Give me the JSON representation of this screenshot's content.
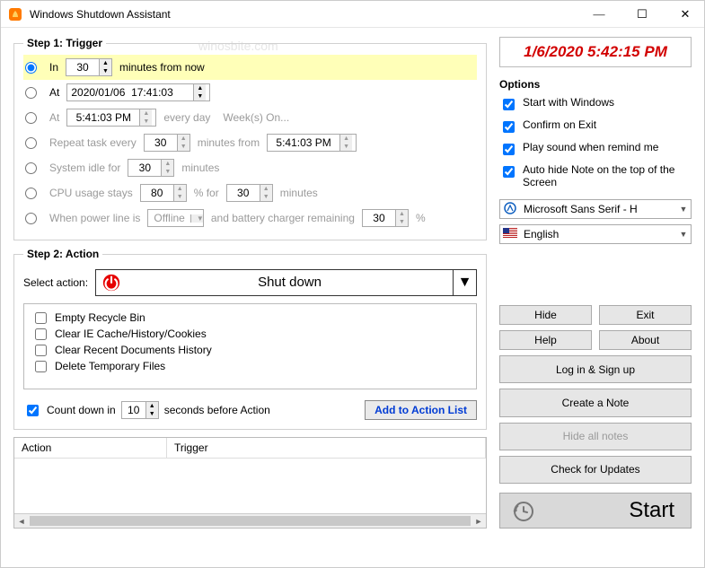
{
  "window": {
    "title": "Windows Shutdown Assistant"
  },
  "watermark": "winosbite.com",
  "step1": {
    "legend": "Step 1: Trigger",
    "in_label": "In",
    "in_value": "30",
    "in_suffix": "minutes from now",
    "at1_label": "At",
    "at1_value": "2020/01/06  17:41:03",
    "at2_label": "At",
    "at2_value": "5:41:03 PM",
    "at2_suffix1": "every day",
    "at2_suffix2": "Week(s) On...",
    "repeat_label": "Repeat task every",
    "repeat_value": "30",
    "repeat_mid": "minutes from",
    "repeat_time": "5:41:03 PM",
    "idle_label": "System idle for",
    "idle_value": "30",
    "idle_suffix": "minutes",
    "cpu_label": "CPU usage stays",
    "cpu_value": "80",
    "cpu_mid": "% for",
    "cpu_min": "30",
    "cpu_suffix": "minutes",
    "power_label": "When power line is",
    "power_state": "Offline",
    "power_mid": "and battery charger remaining",
    "power_val": "30",
    "power_suffix": "%"
  },
  "step2": {
    "legend": "Step 2: Action",
    "select_label": "Select action:",
    "action": "Shut down",
    "checks": {
      "c1": "Empty Recycle Bin",
      "c2": "Clear IE Cache/History/Cookies",
      "c3": "Clear Recent Documents History",
      "c4": "Delete Temporary Files"
    },
    "countdown_label": "Count down in",
    "countdown_value": "10",
    "countdown_suffix": "seconds before Action",
    "add_btn": "Add to Action List"
  },
  "list": {
    "h1": "Action",
    "h2": "Trigger"
  },
  "clock": "1/6/2020 5:42:15 PM",
  "options": {
    "head": "Options",
    "o1": "Start with Windows",
    "o2": "Confirm on Exit",
    "o3": "Play sound when remind me",
    "o4": "Auto hide Note on the top of the Screen"
  },
  "font_select": "Microsoft Sans Serif    - H",
  "lang_select": "English",
  "buttons": {
    "hide": "Hide",
    "exit": "Exit",
    "help": "Help",
    "about": "About",
    "login": "Log in & Sign up",
    "create": "Create a Note",
    "hideall": "Hide all notes",
    "updates": "Check for Updates",
    "start": "Start"
  }
}
